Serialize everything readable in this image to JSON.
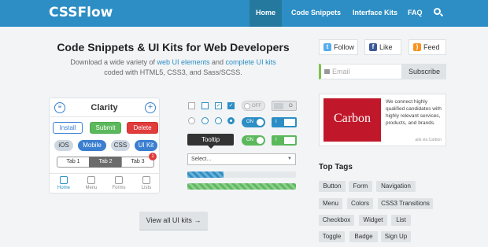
{
  "header": {
    "logo": "CSSFlow",
    "nav": [
      "Home",
      "Code Snippets",
      "Interface Kits",
      "FAQ"
    ]
  },
  "hero": {
    "title": "Code Snippets & UI Kits for Web Developers",
    "sub_prefix": "Download a wide variety of ",
    "sub_link1": "web UI elements",
    "sub_and": " and ",
    "sub_link2": "complete UI kits",
    "sub_line2": "coded with HTML5, CSS3, and Sass/SCSS."
  },
  "phone": {
    "title": "Clarity",
    "buttons": [
      "Install",
      "Submit",
      "Delete"
    ],
    "pills": [
      "iOS",
      "Mobile",
      "CSS",
      "UI Kit"
    ],
    "tabs": [
      "Tab 1",
      "Tab 2",
      "Tab 3"
    ],
    "badge": "1",
    "tabbar": [
      "Home",
      "Menu",
      "Forms",
      "Lists"
    ]
  },
  "widgets": {
    "toggle_off": "OFF",
    "toggle_on": "ON",
    "square_on": "I",
    "square_off": "O",
    "tooltip": "Tooltip",
    "select": "Select..."
  },
  "view_all": "View all UI kits",
  "sidebar": {
    "follow": "Follow",
    "like": "Like",
    "feed": "Feed",
    "email_placeholder": "Email",
    "subscribe": "Subscribe",
    "carbon_logo": "Carbon",
    "carbon_text": "We connect highly qualified candidates with highly relevant services, products, and brands.",
    "carbon_via": "ads via Carbon",
    "top_tags_title": "Top Tags",
    "tags": [
      "Button",
      "Form",
      "Navigation",
      "Menu",
      "Colors",
      "CSS3 Transitions",
      "Checkbox",
      "Widget",
      "List",
      "Toggle",
      "Badge",
      "Sign Up"
    ]
  },
  "colors": {
    "brand": "#2c8ec4",
    "green": "#5cb85c",
    "red": "#e03c3c",
    "twitter": "#55acee",
    "facebook": "#3b5998",
    "feed": "#f7931e"
  }
}
